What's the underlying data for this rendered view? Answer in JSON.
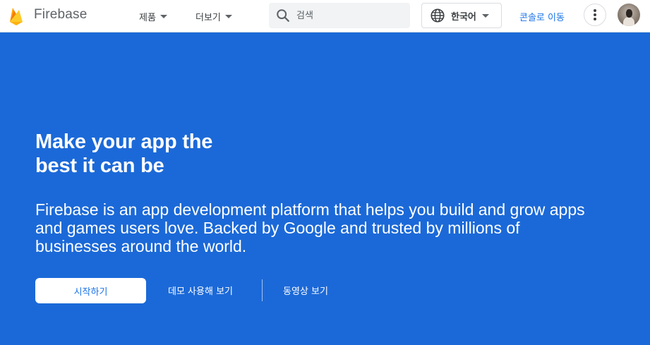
{
  "header": {
    "brand": "Firebase",
    "nav": {
      "products": "제품",
      "more": "더보기"
    },
    "search": {
      "placeholder": "검색"
    },
    "language": "한국어",
    "console": "콘솔로 이동"
  },
  "hero": {
    "headline_lines": [
      "Make your app the",
      "best it can be"
    ],
    "description_lines": [
      "Firebase is an app development platform that helps you build and grow apps",
      "and games users love. Backed by Google and trusted by millions of",
      "businesses around the world."
    ],
    "primary_button": "시작하기",
    "demo_link": "데모 사용해 보기",
    "video_link": "동영상 보기"
  },
  "colors": {
    "hero_bg": "#1b69d8",
    "accent": "#1a73e8"
  },
  "icons": [
    "firebase-logo-icon",
    "chevron-down-icon",
    "search-icon",
    "globe-icon",
    "more-vert-icon"
  ]
}
